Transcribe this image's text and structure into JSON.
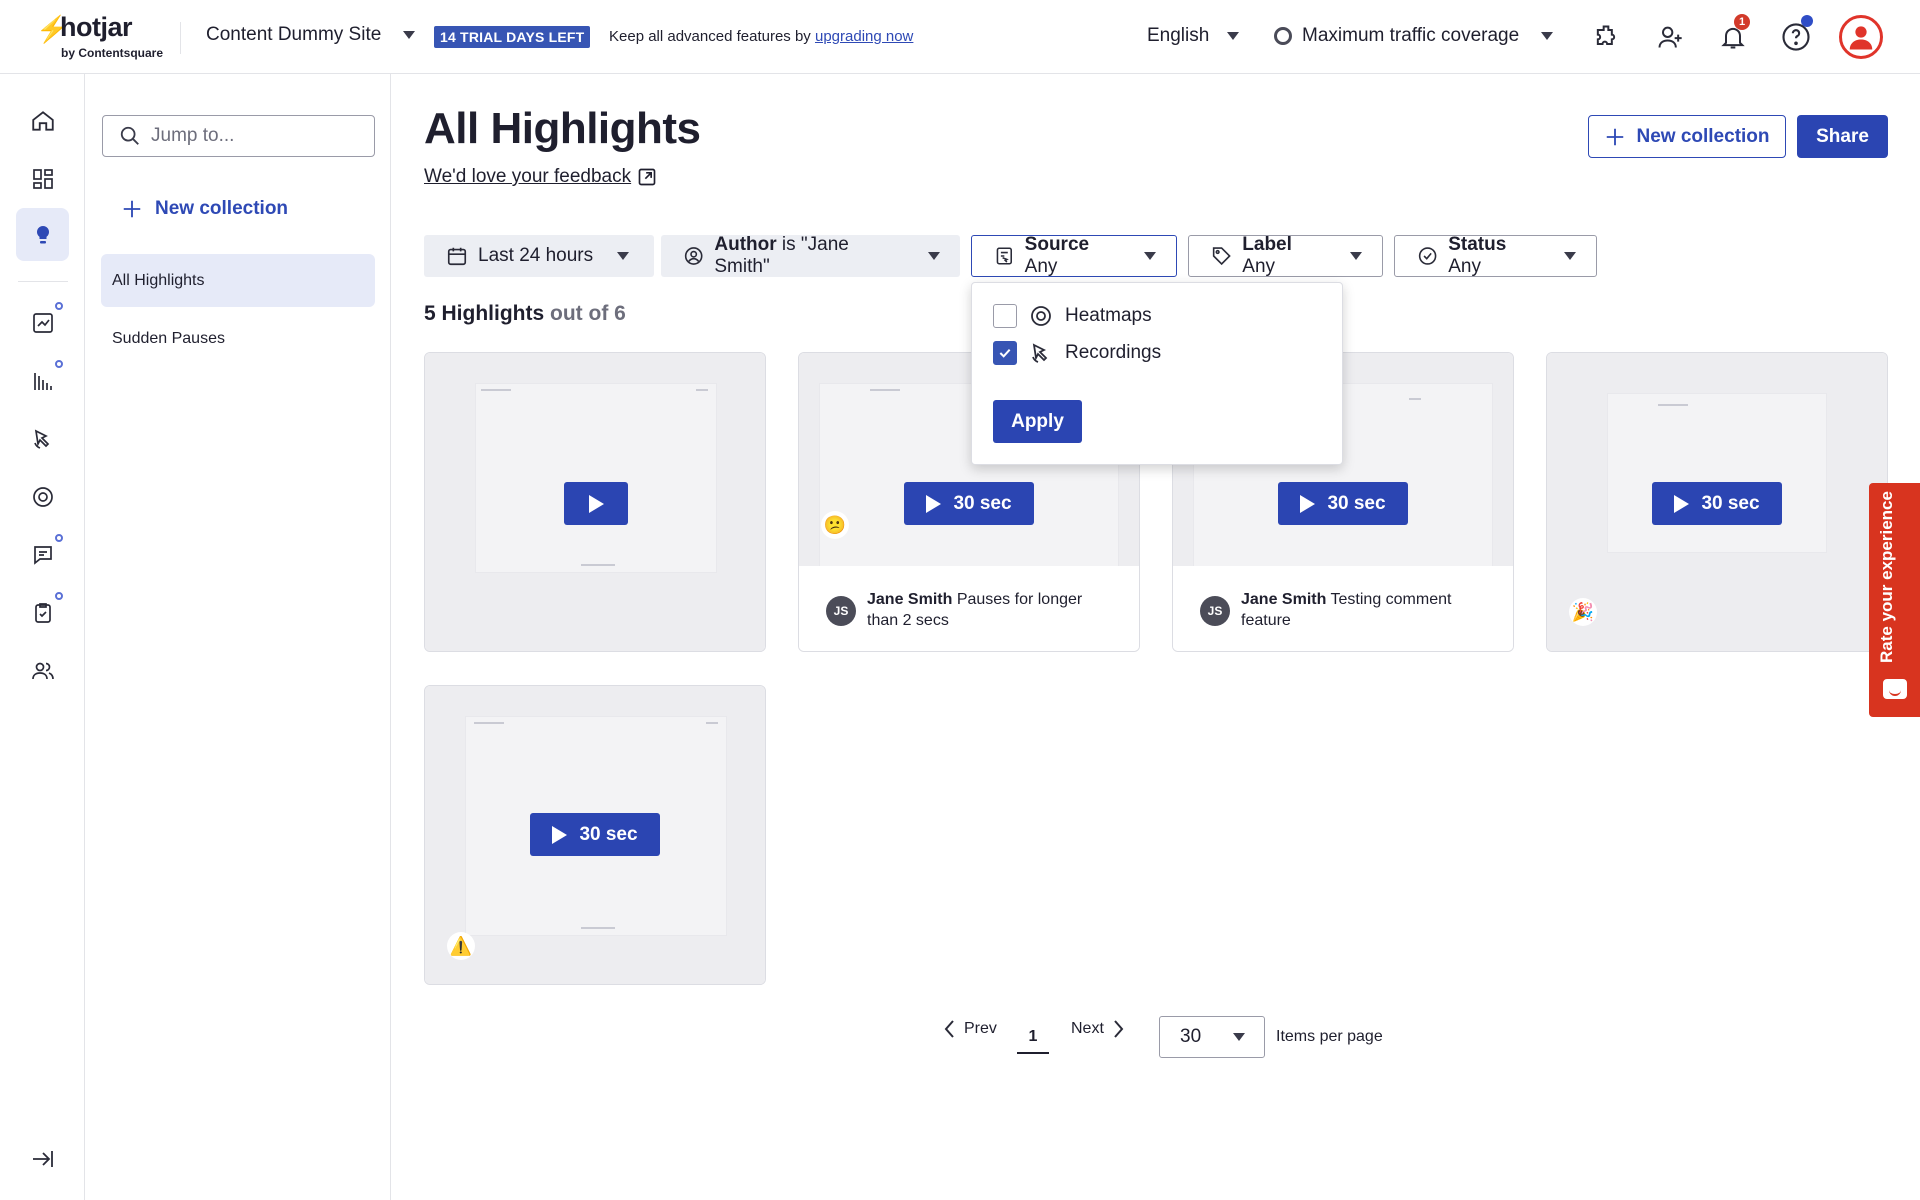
{
  "topbar": {
    "logo_word": "hotjar",
    "logo_by": "by Contentsquare",
    "site": "Content Dummy Site",
    "trial_badge": "14 TRIAL DAYS LEFT",
    "trial_text": "Keep all advanced features by ",
    "trial_link": "upgrading now",
    "language": "English",
    "traffic": "Maximum traffic coverage",
    "notification_count": "1"
  },
  "sidebar": {
    "jump_placeholder": "Jump to...",
    "new_collection": "New collection",
    "collections": [
      "All Highlights",
      "Sudden Pauses"
    ]
  },
  "main": {
    "title": "All Highlights",
    "feedback": "We'd love your feedback",
    "new_collection": "New collection",
    "share": "Share",
    "filters": {
      "date": "Last 24 hours",
      "author_label": "Author",
      "author_value": "is \"Jane Smith\"",
      "source_label": "Source",
      "source_value": "Any",
      "label_label": "Label",
      "label_value": "Any",
      "status_label": "Status",
      "status_value": "Any"
    },
    "count_main": "5 Highlights",
    "count_muted": "out of 6"
  },
  "dropdown": {
    "options": [
      {
        "label": "Heatmaps",
        "checked": false
      },
      {
        "label": "Recordings",
        "checked": true
      }
    ],
    "apply": "Apply"
  },
  "cards": [
    {
      "duration": "",
      "author": "",
      "text": "",
      "emoji": ""
    },
    {
      "duration": "30 sec",
      "author": "Jane Smith",
      "text": "Pauses for longer than 2 secs",
      "initials": "JS",
      "emoji": "😕"
    },
    {
      "duration": "30 sec",
      "author": "Jane Smith",
      "text": "Testing comment feature",
      "initials": "JS",
      "emoji": ""
    },
    {
      "duration": "30 sec",
      "author": "",
      "text": "",
      "emoji": "🎉"
    },
    {
      "duration": "30 sec",
      "author": "",
      "text": "",
      "emoji": "⚠️"
    }
  ],
  "pagination": {
    "prev": "Prev",
    "page": "1",
    "next": "Next",
    "per_page": "30",
    "per_page_label": "Items per page"
  },
  "rate_tab": "Rate your experience",
  "colors": {
    "primary": "#2b45b2",
    "brand": "#f0402a",
    "rate": "#d8341f"
  }
}
